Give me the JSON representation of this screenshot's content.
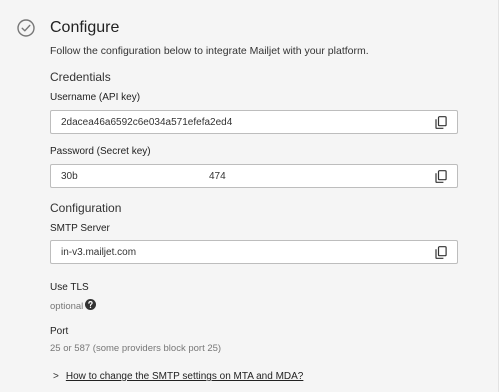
{
  "header": {
    "title": "Configure",
    "intro": "Follow the configuration below to integrate Mailjet with your platform."
  },
  "credentials": {
    "section_title": "Credentials",
    "username_label": "Username (API key)",
    "username_value": "2dacea46a6592c6e034a571efefa2ed4",
    "password_label": "Password (Secret key)",
    "password_value_start": "30b",
    "password_value_end": "474"
  },
  "configuration": {
    "section_title": "Configuration",
    "smtp_label": "SMTP Server",
    "smtp_value": "in-v3.mailjet.com",
    "tls_label": "Use TLS",
    "tls_optional": "optional",
    "port_label": "Port",
    "port_help": "25 or 587 (some providers block port 25)"
  },
  "footer": {
    "chevron": ">",
    "link": "How to change the SMTP settings on MTA and MDA?"
  },
  "icons": {
    "step": "check-circle-icon",
    "copy": "copy-icon",
    "help": "question-circle-icon"
  },
  "colors": {
    "panel_bg": "#f5f5f5",
    "field_border": "#bdbdbd",
    "text_muted": "#777777"
  }
}
